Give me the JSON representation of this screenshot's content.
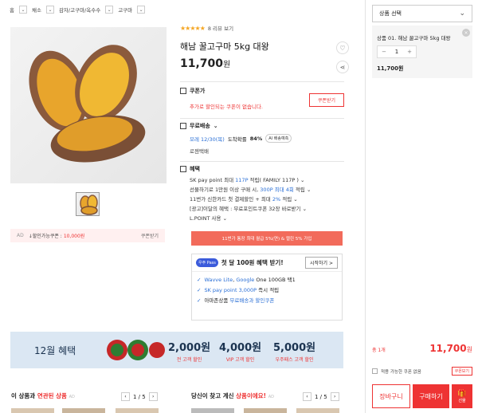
{
  "breadcrumb": [
    "홈",
    "채소",
    "감자/고구마/옥수수",
    "고구마"
  ],
  "rating": {
    "stars": "★★★★★",
    "label": "8 리뷰 보기"
  },
  "product": {
    "title": "해남 꿀고구마 5kg 대왕",
    "price": "11,700",
    "won": "원"
  },
  "ad_coupon": {
    "ad": "AD",
    "label": "↓할인가능쿠폰 :",
    "amount": "10,000원",
    "get": "쿠폰받기"
  },
  "coupon": {
    "title": "쿠폰가",
    "message": "추가로 할인되는 쿠폰이 없습니다.",
    "button": "쿠폰받기"
  },
  "shipping": {
    "title": "무료배송",
    "date": "모레 12/30(목)",
    "arrival": "도착확률",
    "pct": "84%",
    "badge": "AI 배송예측",
    "courier": "로젠택배"
  },
  "benefit": {
    "title": "혜택",
    "lines": [
      {
        "pre": "SK pay point 최대 ",
        "hl": "117P",
        "post": " 적립( FAMILY 117P )"
      },
      {
        "pre": "선물하기로 1만원 이상 구매 시, ",
        "hl": "300P 최대 4회",
        "post": " 적립"
      },
      {
        "pre": "11번가 신한카드 첫 결제할인 + 최대 ",
        "hl": "2%",
        "post": " 적립"
      },
      {
        "pre": "[광고]이달의 혜택 : 무료포인트쿠폰 32장 바로받기",
        "hl": "",
        "post": ""
      },
      {
        "pre": "L.POINT 사용",
        "hl": "",
        "post": ""
      }
    ]
  },
  "promo_bar": "11번가 통장 최대 월급 5%(연) & 캘린 5% 가입",
  "uplus": {
    "logo": "우주 Pass",
    "title": "첫 달 100원 혜택 받기!",
    "start": "시작하기 >",
    "items": [
      {
        "hl": "Wavve Lite",
        "mid": ", ",
        "hl2": "Google",
        "post": " One 100GB 택1"
      },
      {
        "hl": "SK pay point 3,000P",
        "mid": "",
        "hl2": "",
        "post": " 즉시 적립"
      },
      {
        "hl": "",
        "mid": "아마존상품 ",
        "hl2": "무료배송과 할인쿠폰",
        "post": ""
      }
    ]
  },
  "banner": {
    "month": "12월 혜택",
    "cols": [
      {
        "big": "2,000원",
        "small": "전 고객 할인"
      },
      {
        "big": "4,000원",
        "small": "VIP 고객 할인"
      },
      {
        "big": "5,000원",
        "small": "우주패스 고객 할인"
      }
    ]
  },
  "related": {
    "left": {
      "pre": "이 상품과 ",
      "hl": "연관된 상품",
      "ad": "AD",
      "page": "1 / 5"
    },
    "right": {
      "pre": "당신이 찾고 계신 ",
      "hl": "상품이에요!",
      "ad": "AD",
      "page": "1 / 5"
    }
  },
  "side": {
    "select_label": "상품 선택",
    "option_name": "상품 01. 해남 꿀고구마 5kg 대왕",
    "qty": "1",
    "option_price": "11,700원",
    "total_label": "총 1개",
    "total_price": "11,700",
    "total_won": "원",
    "apply_label": "적용 가능한 쿠폰 없음",
    "apply_view": "쿠폰보기",
    "cart": "장바구니",
    "buy": "구매하기",
    "gift": "선물"
  },
  "colors": {
    "accent": "#ee3333",
    "link": "#2a6fd6",
    "banner_bg": "#dbe7f3"
  }
}
